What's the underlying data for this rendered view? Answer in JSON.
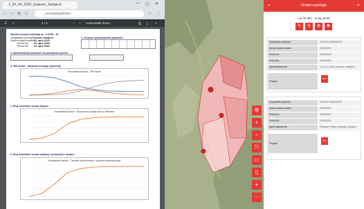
{
  "browser": {
    "tab_title": "1_20_04_2020_Izvjesce_Sarajevo",
    "url": "...eu/oneprj/pdf.html",
    "nav_icons": [
      "back-icon",
      "forward-icon",
      "reload-icon",
      "home-icon"
    ]
  },
  "pdf": {
    "toolbar_text": "1 / 2",
    "zoom_text": "Automatski Zoom",
    "page_num": "1",
    "section1_title": "Nacrtni kocepti izvještaja za - COVID - 19",
    "kv": [
      {
        "k": "Geografsko područje:",
        "v": "Kanton Sarajevo"
      },
      {
        "k": "Datum izrade modela:",
        "v": "20. april 2020."
      },
      {
        "k": "Period od:",
        "v": "20. april 2020."
      },
      {
        "k": "Period do:",
        "v": "24. april 2020."
      }
    ],
    "section1b_title": "1. Osnovni epidemiološki parametri",
    "section2_title": "2. Epidemiološki parametri za posmatrani period",
    "section3_title": "3. SIR model - dinamika kretanja epidemije",
    "chart1_title": "Kumulativni Kanton - SIR model",
    "section4_title": "4. Broj inficiranih osoba ukupno",
    "chart2_title": "Kumulativni Kanton - Ukupan broj osoba koje su inficirane",
    "section5_title": "5. Broj inficiranih osoba sadašnji i procjenjeni ukupno",
    "chart3_title": "Kumulativni Kanton - Trenutni broj inficiranih i procjena ukupnog broja"
  },
  "panel": {
    "title": "Modeli izvještaja",
    "subtitle": "Lat 43.851 - Long 18.38",
    "card1": [
      {
        "k": "Geografsko područje:",
        "v": "KANTON SARAJEVO"
      },
      {
        "k": "Datum izrade modela:",
        "v": "20/04/2020"
      },
      {
        "k": "Period od:",
        "v": "20/04/2020"
      },
      {
        "k": "Period do:",
        "v": "24/04/2020"
      },
      {
        "k": "Naziv dokumenta:",
        "v": "1_20_04_2020_Izvjesce_Sarajevo"
      }
    ],
    "card1_pregled": "Pregled:",
    "card2": [
      {
        "k": "Geografsko područje:",
        "v": "KANTON SARAJEVO"
      },
      {
        "k": "Datum izrade modela:",
        "v": "20/04/2020"
      },
      {
        "k": "Period od:",
        "v": "20/04/2020"
      },
      {
        "k": "Period do:",
        "v": "24/04/2020"
      },
      {
        "k": "Naziv dokumenta:",
        "v": "Pomocni_Podaci_Izvjestaj_Sarajevo"
      }
    ],
    "card2_pregled": "Pregled:",
    "pdf_badge": "PDF",
    "accent": "#e53935"
  },
  "chart_data": [
    {
      "type": "line",
      "title": "Kumulativni Kanton - SIR model",
      "series": [
        {
          "values": [
            0.98,
            0.97,
            0.9,
            0.7,
            0.45,
            0.3,
            0.22,
            0.2,
            0.19,
            0.19
          ]
        },
        {
          "values": [
            0.02,
            0.04,
            0.1,
            0.22,
            0.3,
            0.25,
            0.15,
            0.08,
            0.04,
            0.02
          ]
        },
        {
          "values": [
            0,
            0.01,
            0.03,
            0.08,
            0.22,
            0.42,
            0.6,
            0.7,
            0.75,
            0.78
          ]
        }
      ]
    },
    {
      "type": "line",
      "title": "Kumulativni Kanton - Ukupan broj osoba koje su inficirane",
      "series": [
        {
          "values": [
            0.0,
            0.05,
            0.25,
            0.65,
            0.85,
            0.92,
            0.95,
            0.96,
            0.96,
            0.96
          ]
        }
      ]
    },
    {
      "type": "line",
      "title": "Kumulativni Kanton - Trenutni broj inficiranih i procjena ukupnog broja",
      "series": [
        {
          "values": [
            0.0,
            0.1,
            0.4,
            0.75,
            0.88,
            0.93,
            0.95,
            0.95,
            0.95,
            0.95
          ]
        }
      ]
    }
  ]
}
